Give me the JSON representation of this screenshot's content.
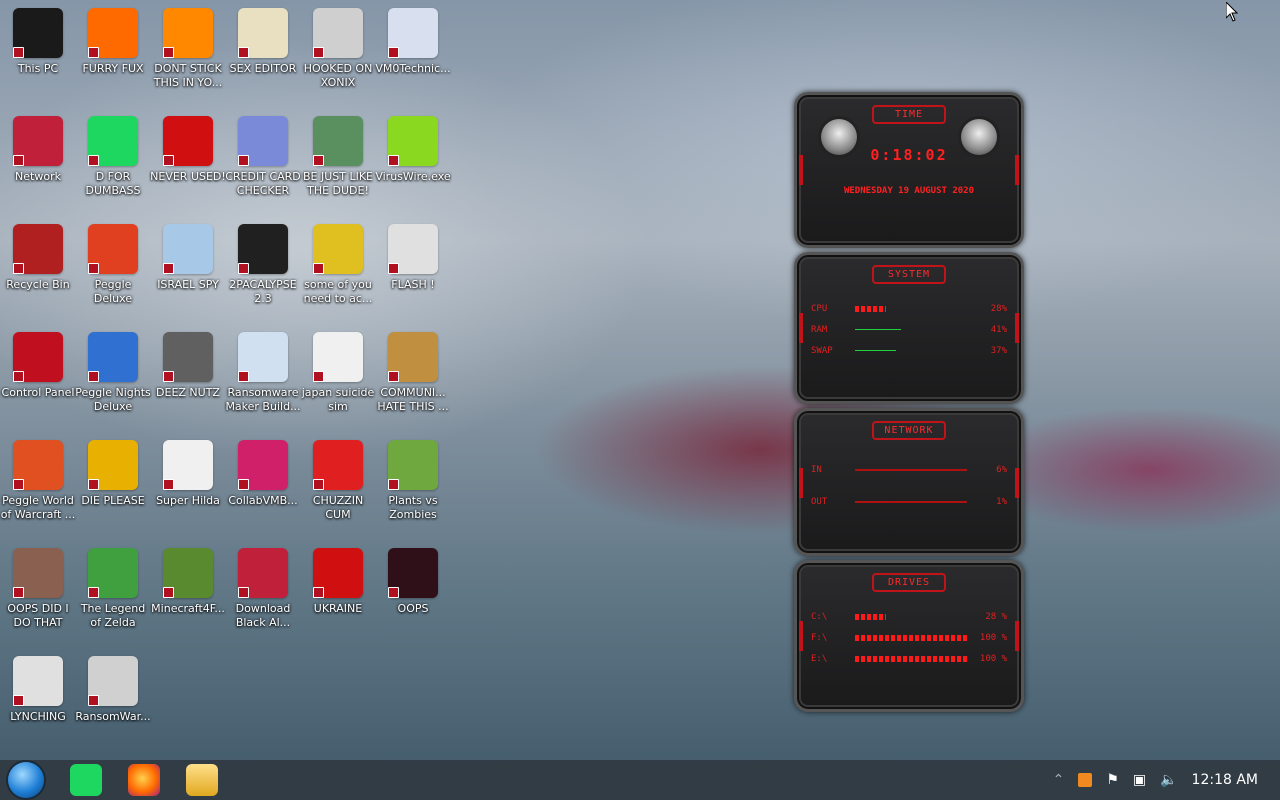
{
  "desktop_icons": [
    {
      "label": "This PC",
      "icon": "monitor-icon",
      "color": "#1a1a1a"
    },
    {
      "label": "FURRY FUX",
      "icon": "firefox-icon",
      "color": "#ff6a00"
    },
    {
      "label": "DONT STICK THIS IN YO...",
      "icon": "vlc-cone-icon",
      "color": "#ff8800"
    },
    {
      "label": "SEX EDITOR",
      "icon": "hxd-icon",
      "color": "#e8e0c0"
    },
    {
      "label": "HOOKED ON XONIX",
      "icon": "xonix-icon",
      "color": "#cfcfcf"
    },
    {
      "label": "VM0Technic...",
      "icon": "doctor-icon",
      "color": "#d8e0f0"
    },
    {
      "label": "Network",
      "icon": "alien-globe-icon",
      "color": "#c0203a"
    },
    {
      "label": "D FOR DUMBASS",
      "icon": "chat-icon",
      "color": "#1ed760"
    },
    {
      "label": "NEVER USED!",
      "icon": "devcpp-icon",
      "color": "#d01010"
    },
    {
      "label": "CREDIT CARD CHECKER",
      "icon": "credit-card-icon",
      "color": "#7a8ad8"
    },
    {
      "label": "BE JUST LIKE THE DUDE!",
      "icon": "santa-icon",
      "color": "#5a9060"
    },
    {
      "label": "VirusWire.exe",
      "icon": "lime-icon",
      "color": "#8ad820"
    },
    {
      "label": "Recycle Bin",
      "icon": "recycle-bin-icon",
      "color": "#b02020"
    },
    {
      "label": "Peggle Deluxe",
      "icon": "peggle-icon",
      "color": "#e04020"
    },
    {
      "label": "ISRAEL SPY",
      "icon": "network-drive-icon",
      "color": "#a8c8e8"
    },
    {
      "label": "2PACALYPSE 2.3",
      "icon": "terminal-icon",
      "color": "#202020"
    },
    {
      "label": "some of you need to ac...",
      "icon": "beaver-icon",
      "color": "#e0c020"
    },
    {
      "label": "FLASH !",
      "icon": "flash-icon",
      "color": "#e0e0e0"
    },
    {
      "label": "Control Panel",
      "icon": "control-panel-icon",
      "color": "#c01020"
    },
    {
      "label": "Peggle Nights Deluxe",
      "icon": "peggle-nights-icon",
      "color": "#3070d0"
    },
    {
      "label": "DEEZ NUTZ",
      "icon": "windows-stack-icon",
      "color": "#606060"
    },
    {
      "label": "Ransomware Maker Build...",
      "icon": "window-app-icon",
      "color": "#d0e0f0"
    },
    {
      "label": "japan suicide sim",
      "icon": "card-icon",
      "color": "#f0f0f0"
    },
    {
      "label": "COMMUNI... HATE THIS ...",
      "icon": "money-bag-icon",
      "color": "#c09040"
    },
    {
      "label": "Peggle World of Warcraft ...",
      "icon": "peggle-wow-icon",
      "color": "#e05020"
    },
    {
      "label": "DIE PLEASE",
      "icon": "de-icon",
      "color": "#e8b000"
    },
    {
      "label": "Super Hilda",
      "icon": "pixel-dog-icon",
      "color": "#f0f0f0"
    },
    {
      "label": "CollabVMB...",
      "icon": "imac-icon",
      "color": "#d0206a"
    },
    {
      "label": "CHUZZIN CUM",
      "icon": "chuzzle-icon",
      "color": "#e02020"
    },
    {
      "label": "Plants vs Zombies",
      "icon": "flower-icon",
      "color": "#70a840"
    },
    {
      "label": "OOPS DID I DO THAT",
      "icon": "portrait-icon",
      "color": "#8a6050"
    },
    {
      "label": "The Legend of Zelda",
      "icon": "pixel-hero-icon",
      "color": "#40a040"
    },
    {
      "label": "Minecraft4F...",
      "icon": "grass-block-icon",
      "color": "#5a8a30"
    },
    {
      "label": "Download Black Al...",
      "icon": "alien-globe-icon",
      "color": "#c0203a"
    },
    {
      "label": "UKRAINE",
      "icon": "radiation-icon",
      "color": "#d01010"
    },
    {
      "label": "OOPS",
      "icon": "dark-box-icon",
      "color": "#301018"
    },
    {
      "label": "LYNCHING",
      "icon": "rope-icon",
      "color": "#e0e0e0"
    },
    {
      "label": "RansomWar...",
      "icon": "skull-icon",
      "color": "#d0d0d0"
    }
  ],
  "widget": {
    "time_title": "TIME",
    "clock": "0:18:02",
    "date": "WEDNESDAY 19 AUGUST 2020",
    "system_title": "SYSTEM",
    "system_rows": [
      {
        "key": "CPU",
        "value": "28%",
        "level": 0.28,
        "kind": "red"
      },
      {
        "key": "RAM",
        "value": "41%",
        "level": 0.41,
        "kind": "green"
      },
      {
        "key": "SWAP",
        "value": "37%",
        "level": 0.37,
        "kind": "green"
      }
    ],
    "network_title": "NETWORK",
    "network_rows": [
      {
        "key": "IN",
        "value": "6%",
        "level": 0.06
      },
      {
        "key": "OUT",
        "value": "1%",
        "level": 0.01
      }
    ],
    "drives_title": "DRIVES",
    "drive_rows": [
      {
        "key": "C:\\",
        "value": "28 %",
        "level": 0.28
      },
      {
        "key": "F:\\",
        "value": "100 %",
        "level": 1.0
      },
      {
        "key": "E:\\",
        "value": "100 %",
        "level": 1.0
      }
    ]
  },
  "taskbar": {
    "pinned": [
      {
        "icon": "start-orb-icon"
      },
      {
        "icon": "chat-app-icon",
        "color": "#1ed760"
      },
      {
        "icon": "firefox-icon",
        "color": "#ff6a00"
      },
      {
        "icon": "file-explorer-icon",
        "color": "#f0c040"
      }
    ],
    "clock": "12:18 AM"
  }
}
